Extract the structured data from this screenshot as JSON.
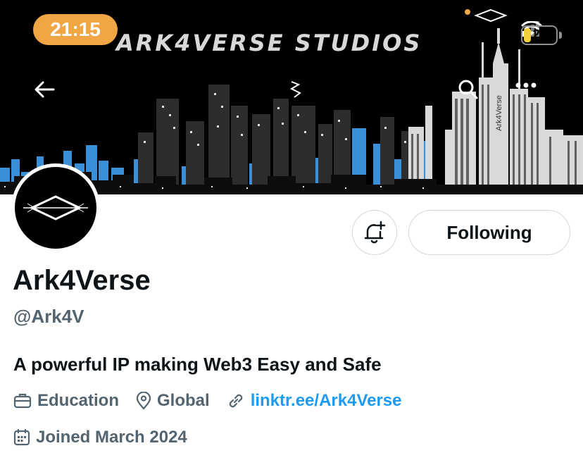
{
  "status_bar": {
    "time": "21:15",
    "battery_level": "20",
    "icons": [
      "signal-icon",
      "wifi-icon",
      "battery-icon"
    ]
  },
  "banner": {
    "title": "ARK4VERSE STUDIOS",
    "tower_label": "Ark4Verse",
    "icons": [
      "back-arrow-icon",
      "search-icon",
      "more-icon"
    ]
  },
  "profile": {
    "display_name": "Ark4Verse",
    "handle": "@Ark4V",
    "bio": "A powerful IP making Web3 Easy and Safe",
    "following_label": "Following",
    "category": "Education",
    "location": "Global",
    "link": "linktr.ee/Ark4Verse",
    "joined": "Joined March 2024"
  },
  "colors": {
    "time_pill": "#f0a644",
    "link": "#1d9bf0",
    "secondary_text": "#536471",
    "border": "#cfd9de",
    "city_blue": "#3a8fd6"
  }
}
